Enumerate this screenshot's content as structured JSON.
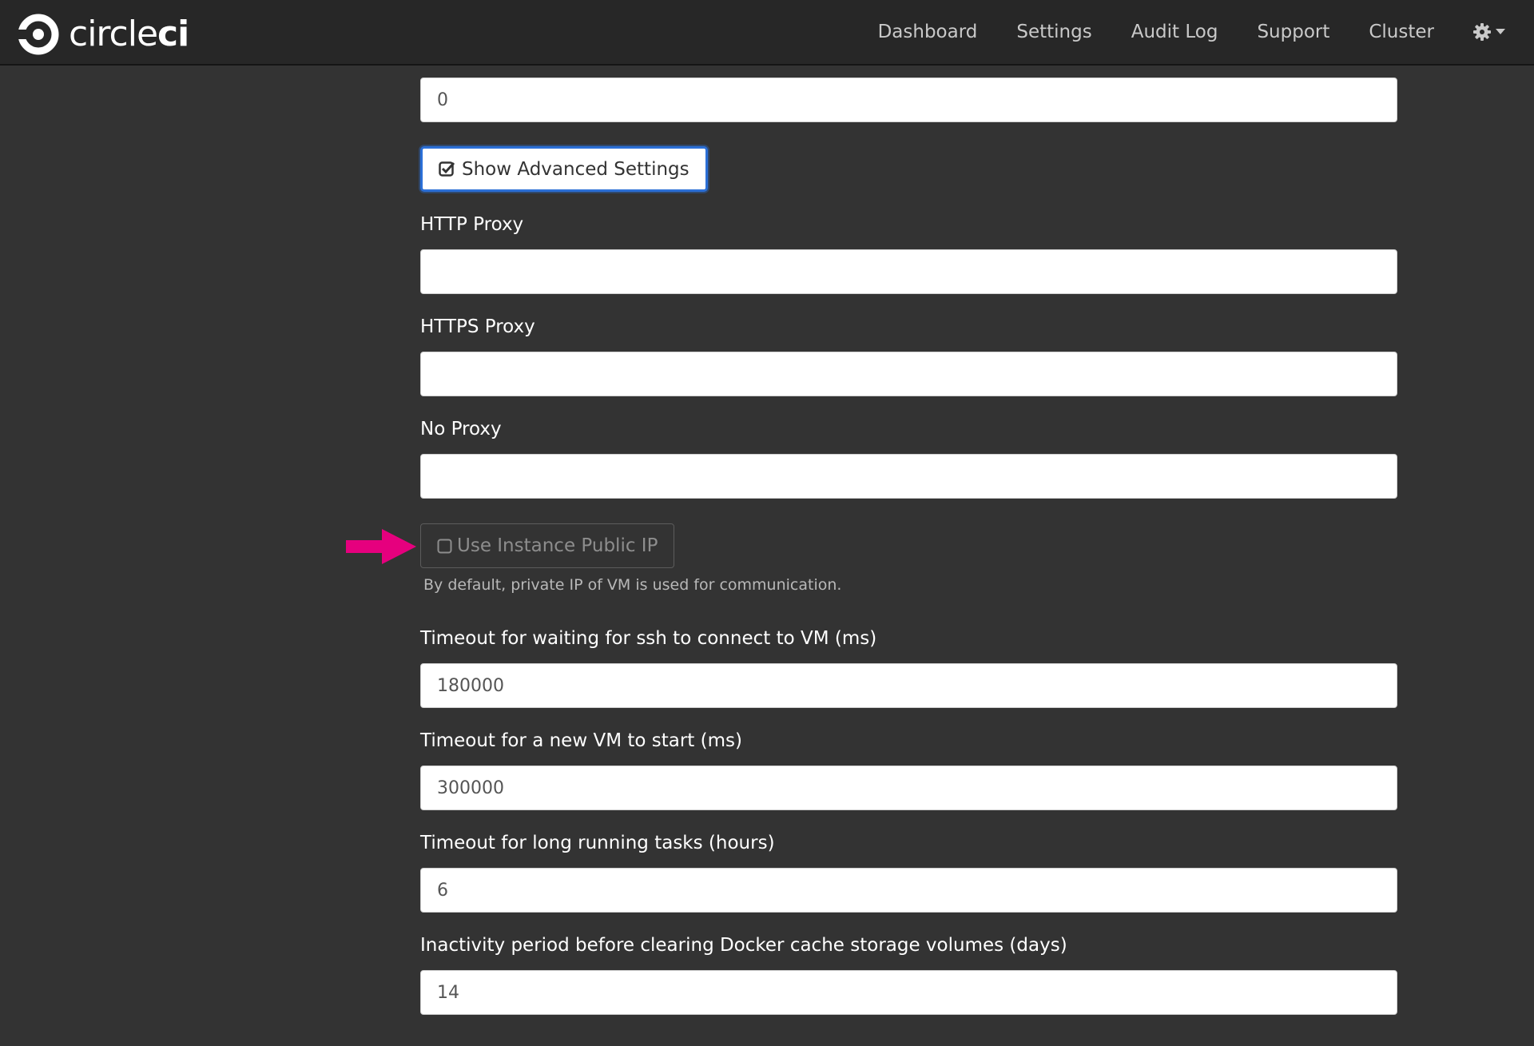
{
  "brand": {
    "name_part1": "circle",
    "name_part2": "ci"
  },
  "nav": {
    "items": [
      {
        "label": "Dashboard"
      },
      {
        "label": "Settings"
      },
      {
        "label": "Audit Log"
      },
      {
        "label": "Support"
      },
      {
        "label": "Cluster"
      }
    ],
    "settings_menu_icon": "gear-icon"
  },
  "form": {
    "top_field_value": "0",
    "advanced_settings": {
      "label": "Show Advanced Settings",
      "checked": true,
      "icon": "check-square-icon"
    },
    "http_proxy": {
      "label": "HTTP Proxy",
      "value": ""
    },
    "https_proxy": {
      "label": "HTTPS Proxy",
      "value": ""
    },
    "no_proxy": {
      "label": "No Proxy",
      "value": ""
    },
    "public_ip": {
      "label": "Use Instance Public IP",
      "checked": false,
      "icon": "empty-square-icon",
      "help": "By default, private IP of VM is used for communication."
    },
    "ssh_timeout": {
      "label": "Timeout for waiting for ssh to connect to VM (ms)",
      "value": "180000"
    },
    "vm_start_timeout": {
      "label": "Timeout for a new VM to start (ms)",
      "value": "300000"
    },
    "long_task_timeout": {
      "label": "Timeout for long running tasks (hours)",
      "value": "6"
    },
    "docker_cache_inactivity": {
      "label": "Inactivity period before clearing Docker cache storage volumes (days)",
      "value": "14"
    }
  },
  "annotation": {
    "arrow_color": "#e6007e"
  },
  "colors": {
    "background": "#333333",
    "navbar": "#272727",
    "focus_blue": "#2b6fd6"
  }
}
